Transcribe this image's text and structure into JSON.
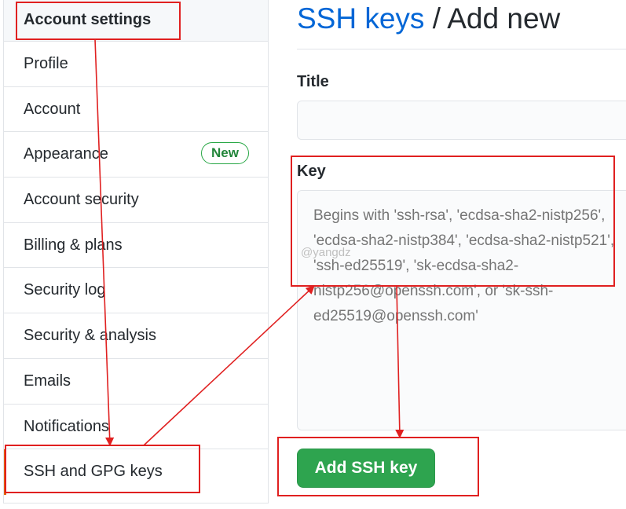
{
  "sidebar": {
    "header": "Account settings",
    "items": [
      {
        "label": "Profile"
      },
      {
        "label": "Account"
      },
      {
        "label": "Appearance",
        "badge": "New"
      },
      {
        "label": "Account security"
      },
      {
        "label": "Billing & plans"
      },
      {
        "label": "Security log"
      },
      {
        "label": "Security & analysis"
      },
      {
        "label": "Emails"
      },
      {
        "label": "Notifications"
      },
      {
        "label": "SSH and GPG keys",
        "selected": true
      }
    ]
  },
  "main": {
    "breadcrumb_link": "SSH keys",
    "breadcrumb_sep": " / ",
    "breadcrumb_current": "Add new",
    "title_label": "Title",
    "title_value": "",
    "key_label": "Key",
    "key_placeholder": "Begins with 'ssh-rsa', 'ecdsa-sha2-nistp256', 'ecdsa-sha2-nistp384', 'ecdsa-sha2-nistp521', 'ssh-ed25519', 'sk-ecdsa-sha2-nistp256@openssh.com', or 'sk-ssh-ed25519@openssh.com'",
    "add_button": "Add SSH key"
  },
  "watermark": "@yangdz",
  "colors": {
    "link": "#0366d6",
    "primary_button": "#2ea44f",
    "selected_accent": "#e36209",
    "annotation": "#e02020"
  }
}
